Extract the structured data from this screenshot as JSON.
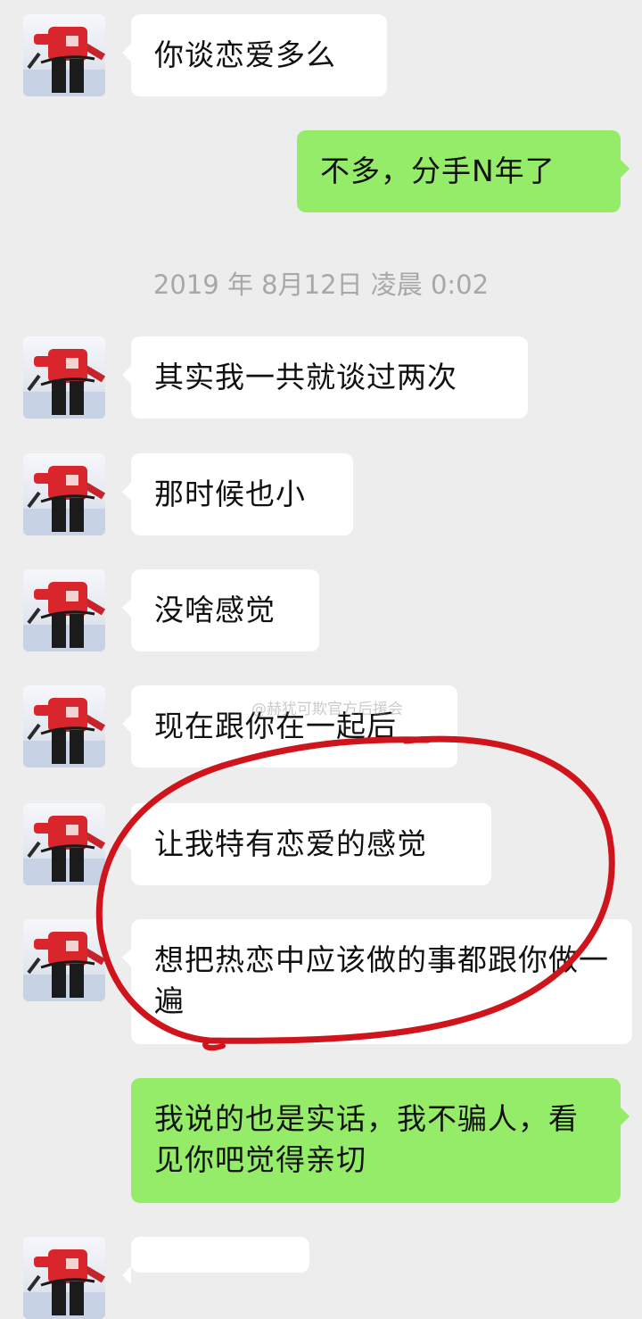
{
  "timestamp": "2019 年 8月12日 凌晨 0:02",
  "watermark": "@赫犹可欺官方后援会",
  "annotation": {
    "shape": "hand-drawn circle",
    "color": "#d0141c"
  },
  "messages": [
    {
      "side": "in",
      "text": "你谈恋爱多么"
    },
    {
      "side": "out",
      "text": "不多，分手N年了"
    },
    {
      "side": "in",
      "text": "其实我一共就谈过两次"
    },
    {
      "side": "in",
      "text": "那时候也小"
    },
    {
      "side": "in",
      "text": "没啥感觉"
    },
    {
      "side": "in",
      "text": "现在跟你在一起后"
    },
    {
      "side": "in",
      "text": "让我特有恋爱的感觉"
    },
    {
      "side": "in",
      "text": "想把热恋中应该做的事都跟你做一遍"
    },
    {
      "side": "out",
      "text": "我说的也是实话，我不骗人，看见你吧觉得亲切"
    }
  ],
  "colors": {
    "background": "#ededed",
    "incoming": "#ffffff",
    "outgoing": "#95ec69",
    "timestamp": "#a8a8a8"
  }
}
